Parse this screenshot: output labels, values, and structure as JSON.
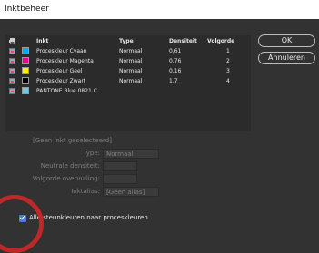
{
  "window": {
    "title": "Inktbeheer"
  },
  "table": {
    "headers": {
      "ink": "Inkt",
      "type": "Type",
      "density": "Densiteit",
      "order": "Volgorde"
    },
    "rows": [
      {
        "name": "Proceskleur Cyaan",
        "type": "Normaal",
        "density": "0,61",
        "order": "1",
        "color": "#00aeef"
      },
      {
        "name": "Proceskleur Magenta",
        "type": "Normaal",
        "density": "0,76",
        "order": "2",
        "color": "#ec008c"
      },
      {
        "name": "Proceskleur Geel",
        "type": "Normaal",
        "density": "0,16",
        "order": "3",
        "color": "#fff200"
      },
      {
        "name": "Proceskleur Zwart",
        "type": "Normaal",
        "density": "1,7",
        "order": "4",
        "color": "#000000"
      },
      {
        "name": "PANTONE Blue 0821 C",
        "type": "",
        "density": "",
        "order": "",
        "color": "#72c7e7"
      }
    ]
  },
  "buttons": {
    "ok": "OK",
    "cancel": "Annuleren"
  },
  "details": {
    "group_title": "[Geen inkt geselecteerd]",
    "type_label": "Type:",
    "type_value": "Normaal",
    "density_label": "Neutrale densiteit:",
    "trapping_label": "Volgorde overvulling:",
    "alias_label": "Inktalias:",
    "alias_value": "[Geen alias]"
  },
  "checkbox": {
    "label": "Alle steunkleuren naar proceskleuren",
    "checked": true
  },
  "colors": {
    "accent": "#4a7bd5",
    "highlight_ring": "#c62828"
  }
}
